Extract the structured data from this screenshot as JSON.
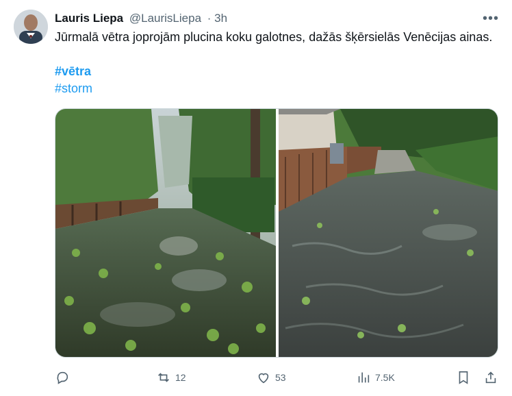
{
  "author": {
    "name": "Lauris Liepa",
    "handle": "@LaurisLiepa",
    "time": "· 3h"
  },
  "tweet_text": "Jūrmalā vētra joprojām plucina koku galotnes, dažās šķērsielās Venēcijas ainas.",
  "hashtags": [
    "#vētra",
    "#storm"
  ],
  "actions": {
    "retweets": "12",
    "likes": "53",
    "views": "7.5K"
  },
  "icons": [
    "more-icon",
    "reply-icon",
    "retweet-icon",
    "like-icon",
    "views-icon",
    "bookmark-icon",
    "share-icon"
  ]
}
